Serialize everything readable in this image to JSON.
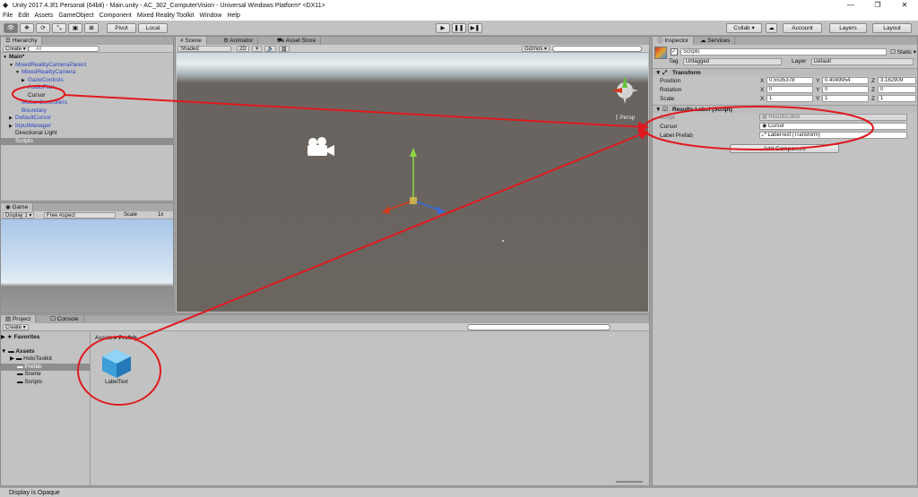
{
  "window": {
    "title": "Unity 2017.4.3f1 Personal (64bit) - Main.unity - AC_302_ComputerVision - Universal Windows Platform* <DX11>",
    "minimize": "—",
    "maximize": "❐",
    "close": "✕"
  },
  "menu": [
    "File",
    "Edit",
    "Assets",
    "GameObject",
    "Component",
    "Mixed Reality Toolkit",
    "Window",
    "Help"
  ],
  "toolbar": {
    "pivot_label": "Pivot",
    "local_label": "Local",
    "collab_label": "Collab ▾",
    "account_label": "Account",
    "layers_label": "Layers",
    "layout_label": "Layout"
  },
  "hierarchy": {
    "tab": "Hierarchy",
    "create": "Create ▾",
    "search_placeholder": "All",
    "rows": [
      {
        "text": "Main*",
        "indent": 0,
        "arrow": "▼",
        "bold": true
      },
      {
        "text": "MixedRealityCameraParent",
        "indent": 1,
        "arrow": "▼",
        "blue": true
      },
      {
        "text": "MixedRealityCamera",
        "indent": 2,
        "arrow": "▼",
        "blue": true
      },
      {
        "text": "GazeControls",
        "indent": 3,
        "arrow": "▶",
        "blue": true
      },
      {
        "text": "AudioPlan",
        "indent": 3,
        "arrow": "",
        "blue": true
      },
      {
        "text": "Cursor",
        "indent": 3,
        "arrow": "",
        "blue": false
      },
      {
        "text": "MotionControllers",
        "indent": 2,
        "arrow": "",
        "blue": true
      },
      {
        "text": "Boundary",
        "indent": 2,
        "arrow": "",
        "blue": true
      },
      {
        "text": "DefaultCursor",
        "indent": 1,
        "arrow": "▶",
        "blue": true
      },
      {
        "text": "InputManager",
        "indent": 1,
        "arrow": "▶",
        "blue": true
      },
      {
        "text": "Directional Light",
        "indent": 1,
        "arrow": "",
        "blue": false
      },
      {
        "text": "Scripts",
        "indent": 1,
        "arrow": "",
        "blue": false,
        "selected": true
      }
    ]
  },
  "scene": {
    "tabs": [
      "Scene",
      "Animator",
      "Asset Store"
    ],
    "shading": "Shaded",
    "mode_2d": "2D",
    "gizmos": "Gizmos ▾",
    "persp_label": "Persp"
  },
  "game": {
    "tab": "Game",
    "display": "Display 1",
    "aspect": "Free Aspect",
    "scale_label": "Scale",
    "scale_value": "1x"
  },
  "project": {
    "tabs": [
      "Project",
      "Console"
    ],
    "create": "Create ▾",
    "favorites": "Favorites",
    "assets": "Assets",
    "folders": [
      "HoloToolkit",
      "Prefab",
      "Scene",
      "Scripts"
    ],
    "breadcrumb_root": "Assets",
    "breadcrumb_leaf": "Prefab",
    "asset_name": "LabelText"
  },
  "inspector": {
    "tabs": [
      "Inspector",
      "Services"
    ],
    "object_name": "Scripts",
    "static_label": "Static",
    "tag_label": "Tag",
    "tag_value": "Untagged",
    "layer_label": "Layer",
    "layer_value": "Default",
    "transform_title": "Transform",
    "position_label": "Position",
    "rotation_label": "Rotation",
    "scale_label": "Scale",
    "position": {
      "x": "0.5535378",
      "y": "0.4049954",
      "z": "3.162909"
    },
    "rotation": {
      "x": "0",
      "y": "0",
      "z": "0"
    },
    "scale": {
      "x": "1",
      "y": "1",
      "z": "1"
    },
    "component_title": "Results Label (Script)",
    "script_label": "Script",
    "script_value": "ResultsLabel",
    "cursor_label": "Cursor",
    "cursor_value": "Cursor",
    "label_prefab_label": "Label Prefab",
    "label_prefab_value": "LabelText (Transform)",
    "add_component": "Add Component"
  },
  "status": {
    "text": "Display is Opaque"
  },
  "annotation_color": "#e0191e"
}
